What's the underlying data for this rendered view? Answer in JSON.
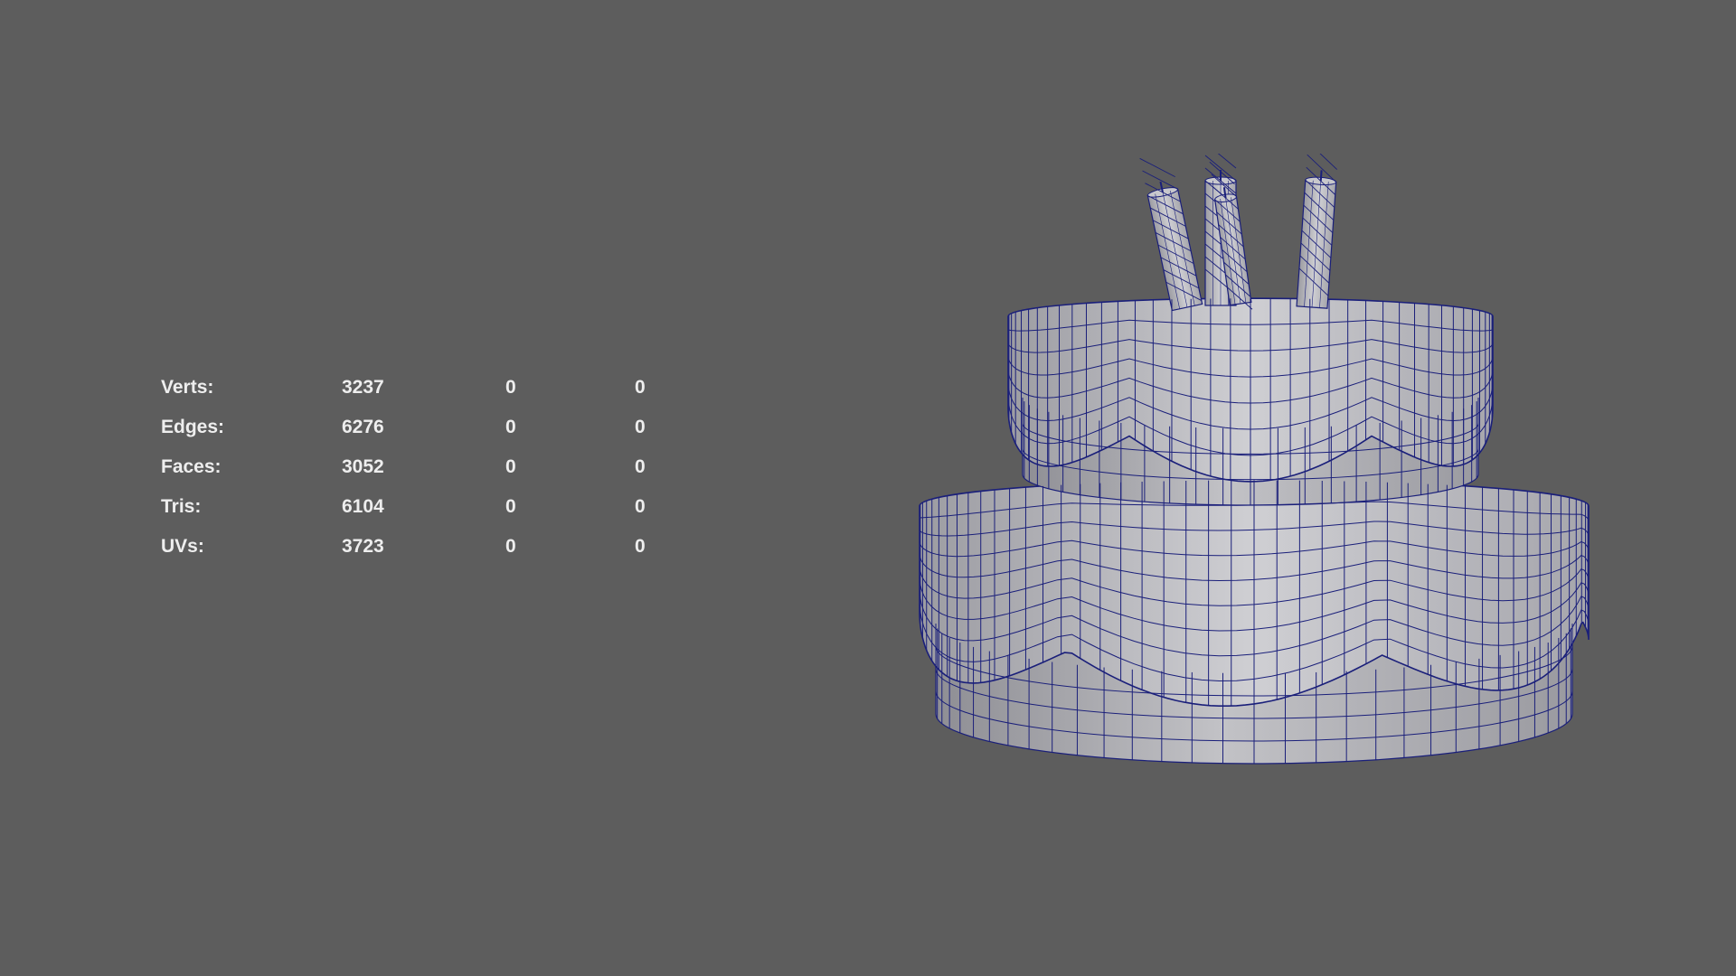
{
  "viewport": {
    "background_color": "#5d5d5d",
    "wireframe_color": "#1a1f7a",
    "surface_color": "#b4b4b8"
  },
  "hud": {
    "rows": [
      {
        "label": "Verts:",
        "value": "3237",
        "selected": "0",
        "uv_selected": "0"
      },
      {
        "label": "Edges:",
        "value": "6276",
        "selected": "0",
        "uv_selected": "0"
      },
      {
        "label": "Faces:",
        "value": "3052",
        "selected": "0",
        "uv_selected": "0"
      },
      {
        "label": "Tris:",
        "value": "6104",
        "selected": "0",
        "uv_selected": "0"
      },
      {
        "label": "UVs:",
        "value": "3723",
        "selected": "0",
        "uv_selected": "0"
      }
    ]
  },
  "model": {
    "object": "cake-wireframe-mesh",
    "candle_count": 4
  }
}
